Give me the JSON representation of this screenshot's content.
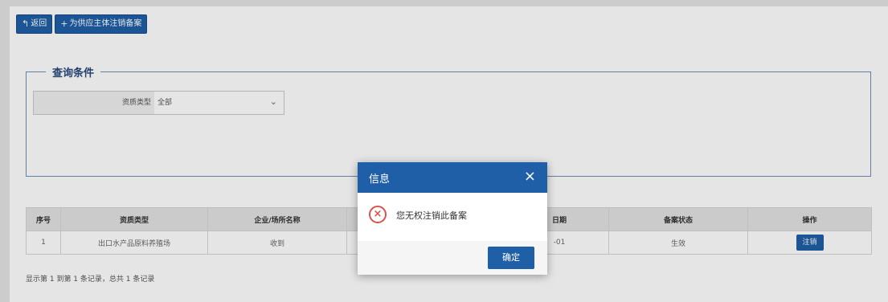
{
  "toolbar": {
    "back_label": "返回",
    "add_label": "为供应主体注销备案"
  },
  "query": {
    "legend": "查询条件",
    "filter_label": "资质类型",
    "filter_value": "全部"
  },
  "table": {
    "headers": [
      "序号",
      "资质类型",
      "企业/场所名称",
      "",
      "日期",
      "备案状态",
      "操作"
    ],
    "rows": [
      [
        "1",
        "出口水产品原料养殖场",
        "收到",
        "",
        "-01",
        "生效",
        "注销"
      ]
    ]
  },
  "pager": {
    "text": "显示第 1 到第 1 条记录，总共 1 条记录"
  },
  "dialog": {
    "title": "信息",
    "close_glyph": "×",
    "message": "您无权注销此备案",
    "ok_label": "确定",
    "error_glyph": "×"
  },
  "colors": {
    "primary": "#1f5fa8",
    "error": "#d9534f"
  }
}
